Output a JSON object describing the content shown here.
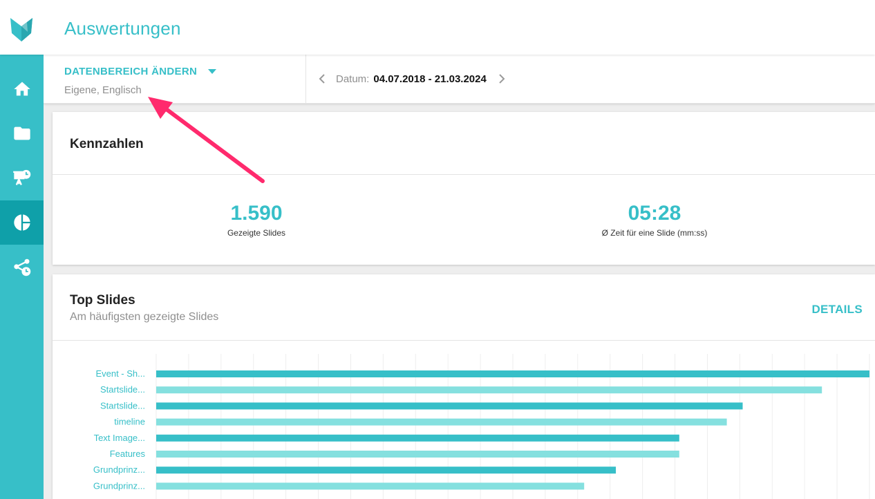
{
  "header": {
    "title": "Auswertungen",
    "brand_color": "#37bfc8"
  },
  "sidebar": {
    "active_color": "#0fa0a9",
    "items": [
      {
        "id": "home",
        "icon": "home-icon",
        "active": false
      },
      {
        "id": "files",
        "icon": "folder-icon",
        "active": false
      },
      {
        "id": "presentations",
        "icon": "presentation-clock-icon",
        "active": false
      },
      {
        "id": "analytics",
        "icon": "pie-chart-icon",
        "active": true
      },
      {
        "id": "share",
        "icon": "share-clock-icon",
        "active": false
      }
    ]
  },
  "filter": {
    "range_label": "DATENBEREICH ÄNDERN",
    "range_value": "Eigene, Englisch",
    "date_prefix": "Datum:",
    "date_value": "04.07.2018 - 21.03.2024"
  },
  "kpis": {
    "title": "Kennzahlen",
    "items": [
      {
        "value": "1.590",
        "label": "Gezeigte Slides"
      },
      {
        "value": "05:28",
        "label": "Ø Zeit für eine Slide (mm:ss)"
      }
    ]
  },
  "top_slides": {
    "title": "Top Slides",
    "subtitle": "Am häufigsten gezeigte Slides",
    "details_label": "DETAILS"
  },
  "chart_data": {
    "type": "bar",
    "orientation": "horizontal",
    "categories": [
      "Event - Sh...",
      "Startslide...",
      "Startslide...",
      "timeline",
      "Text Image...",
      "Features",
      "Grundprinz...",
      "Grundprinz..."
    ],
    "values": [
      45,
      42,
      37,
      36,
      33,
      33,
      29,
      27
    ],
    "xlim": [
      0,
      45
    ],
    "grid": true,
    "colors": [
      "#37bfc8",
      "#85e0df"
    ]
  }
}
